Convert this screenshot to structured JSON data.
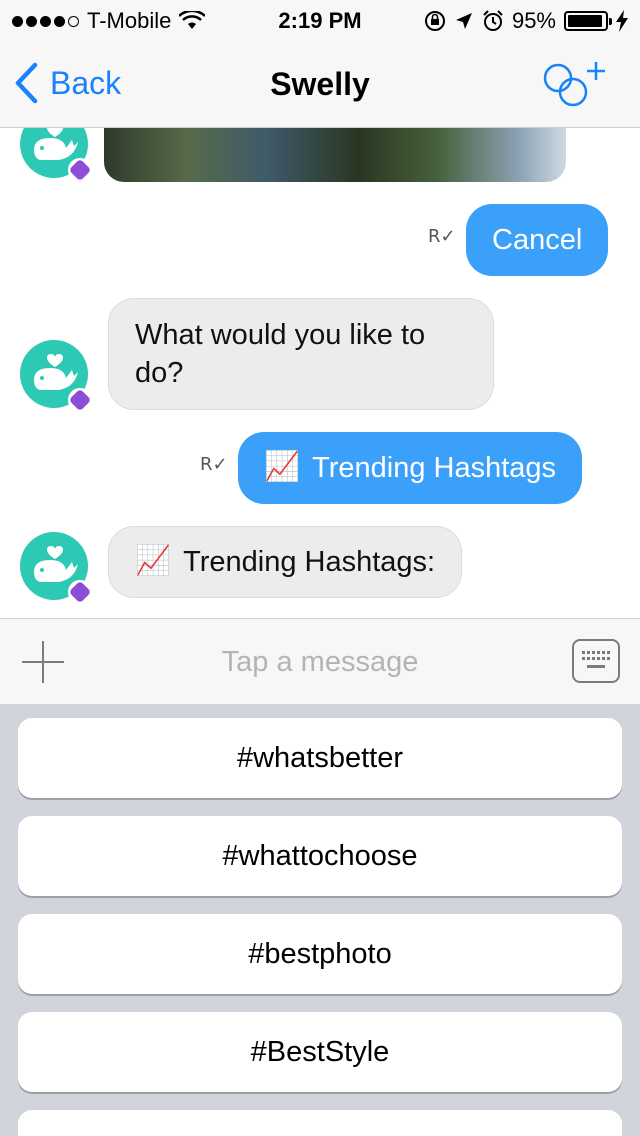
{
  "status_bar": {
    "carrier": "T-Mobile",
    "time": "2:19 PM",
    "battery": "95%",
    "battery_fraction": 0.95,
    "signal_bars_filled": 4,
    "signal_bars_total": 5
  },
  "nav": {
    "back_label": "Back",
    "title": "Swelly"
  },
  "messages": [
    {
      "type": "image",
      "direction": "in"
    },
    {
      "type": "text",
      "direction": "out",
      "text": "Cancel"
    },
    {
      "type": "text",
      "direction": "in",
      "text": "What would you like to do?"
    },
    {
      "type": "text",
      "direction": "out",
      "emoji": "📈",
      "text": "Trending Hashtags"
    },
    {
      "type": "text",
      "direction": "in",
      "emoji": "📈",
      "text": "Trending Hashtags:"
    }
  ],
  "input": {
    "placeholder": "Tap a message"
  },
  "suggestions": [
    "#whatsbetter",
    "#whattochoose",
    "#bestphoto",
    "#BestStyle",
    ""
  ],
  "colors": {
    "accent_blue": "#1a82fb",
    "bubble_blue": "#3aa0f9",
    "avatar_teal": "#2ec9b5",
    "keyboard_gray": "#d1d5db"
  }
}
